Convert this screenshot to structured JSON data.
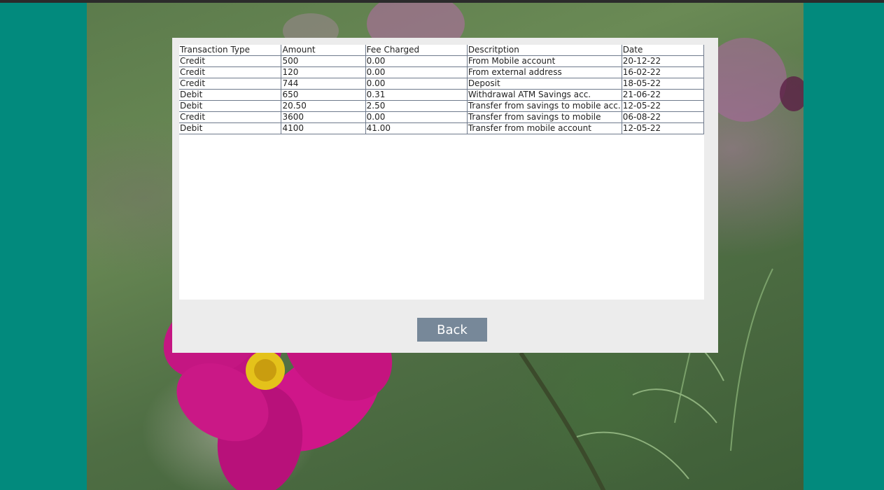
{
  "table": {
    "columns": [
      "Transaction Type",
      "Amount",
      "Fee Charged",
      "Descritption",
      "Date"
    ],
    "rows": [
      [
        "Credit",
        "500",
        "0.00",
        "From Mobile account",
        "20-12-22"
      ],
      [
        "Credit",
        "120",
        "0.00",
        "From external address",
        "16-02-22"
      ],
      [
        "Credit",
        "744",
        "0.00",
        "Deposit",
        "18-05-22"
      ],
      [
        "Debit",
        "650",
        "0.31",
        "Withdrawal ATM Savings acc.",
        "21-06-22"
      ],
      [
        "Debit",
        "20.50",
        "2.50",
        "Transfer from savings to mobile acc.",
        "12-05-22"
      ],
      [
        "Credit",
        "3600",
        "0.00",
        "Transfer from savings to mobile",
        "06-08-22"
      ],
      [
        "Debit",
        "4100",
        "41.00",
        "Transfer from mobile account",
        "12-05-22"
      ]
    ]
  },
  "actions": {
    "back_label": "Back"
  },
  "colors": {
    "page_background": "#028a7d",
    "panel_background": "#ececec",
    "button_background": "#778899",
    "table_border": "#6f7a8c"
  }
}
